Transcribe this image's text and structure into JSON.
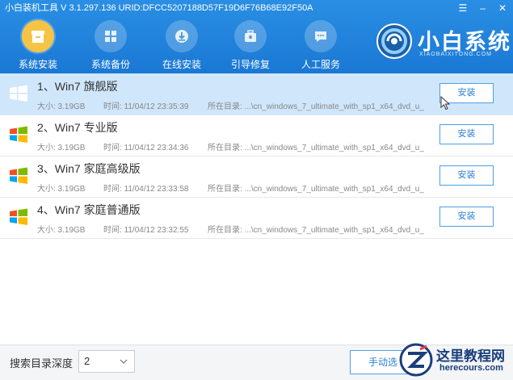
{
  "window": {
    "title": "小白装机工具 V 3.1.297.136 URID:DFCC5207188D57F19D6F76B68E92F50A",
    "controls": {
      "menu": "☰",
      "minimize": "–",
      "close": "✕"
    }
  },
  "nav": {
    "items": [
      {
        "label": "系统安装",
        "icon": "box-icon",
        "active": true
      },
      {
        "label": "系统备份",
        "icon": "windows-icon",
        "active": false
      },
      {
        "label": "在线安装",
        "icon": "download-icon",
        "active": false
      },
      {
        "label": "引导修复",
        "icon": "toolbox-icon",
        "active": false
      },
      {
        "label": "人工服务",
        "icon": "chat-icon",
        "active": false
      }
    ]
  },
  "brand": {
    "name": "小白系统",
    "subtitle": "XIAOBAIXITONG.COM"
  },
  "list": {
    "items": [
      {
        "name": "1、Win7 旗舰版",
        "size": "大小: 3.19GB",
        "time": "时间: 11/04/12 23:35:39",
        "path": "所在目录: ...\\cn_windows_7_ultimate_with_sp1_x64_dvd_u_",
        "button": "安装",
        "selected": true
      },
      {
        "name": "2、Win7 专业版",
        "size": "大小: 3.19GB",
        "time": "时间: 11/04/12 23:34:36",
        "path": "所在目录: ...\\cn_windows_7_ultimate_with_sp1_x64_dvd_u_",
        "button": "安装",
        "selected": false
      },
      {
        "name": "3、Win7 家庭高级版",
        "size": "大小: 3.19GB",
        "time": "时间: 11/04/12 23:33:58",
        "path": "所在目录: ...\\cn_windows_7_ultimate_with_sp1_x64_dvd_u_",
        "button": "安装",
        "selected": false
      },
      {
        "name": "4、Win7 家庭普通版",
        "size": "大小: 3.19GB",
        "time": "时间: 11/04/12 23:32:55",
        "path": "所在目录: ...\\cn_windows_7_ultimate_with_sp1_x64_dvd_u_",
        "button": "安装",
        "selected": false
      }
    ]
  },
  "footer": {
    "depth_label": "搜索目录深度",
    "depth_value": "2",
    "manual_button": "手动选"
  },
  "watermark": {
    "cn": "这里教程网",
    "en": "herecours.com"
  },
  "colors": {
    "header": "#1a78d4",
    "active_nav": "#f6c445",
    "selected_row": "#cfe6fb",
    "button_border": "#4e9ee6",
    "button_text": "#2b7fd4"
  }
}
